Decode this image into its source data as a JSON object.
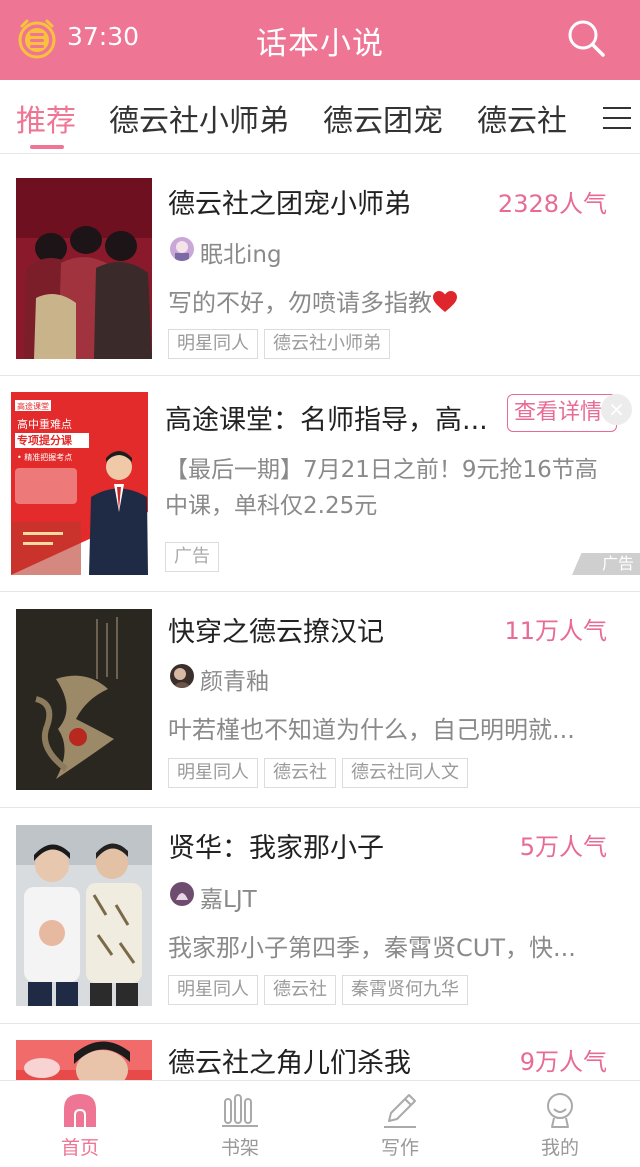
{
  "header": {
    "timer": "37:30",
    "title": "话本小说",
    "coin_icon": "coin-timer-icon",
    "search_icon": "search-icon"
  },
  "tabs": [
    {
      "label": "推荐",
      "active": true
    },
    {
      "label": "德云社小师弟"
    },
    {
      "label": "德云团宠"
    },
    {
      "label": "德云社"
    }
  ],
  "feed": {
    "books": [
      {
        "title": "德云社之团宠小师弟",
        "popularity": "2328人气",
        "author": "眠北ing",
        "description": "写的不好，勿喷请多指教",
        "tags": [
          "明星同人",
          "德云社小师弟"
        ]
      },
      {
        "title": "快穿之德云撩汉记",
        "popularity": "11万人气",
        "author": "颜青釉",
        "description": "叶若槿也不知道为什么，自己明明就...",
        "tags": [
          "明星同人",
          "德云社",
          "德云社同人文"
        ]
      },
      {
        "title": "贤华：我家那小子",
        "popularity": "5万人气",
        "author": "嘉LJT",
        "description": "我家那小子第四季，秦霄贤CUT，快...",
        "tags": [
          "明星同人",
          "德云社",
          "秦霄贤何九华"
        ]
      },
      {
        "title": "德云社之角儿们杀我",
        "popularity": "9万人气"
      }
    ],
    "ad": {
      "title": "高途课堂：名师指导，高...",
      "button": "查看详情",
      "close": "×",
      "description": "【最后一期】7月21日之前！9元抢16节高中课，单科仅2.25元",
      "tag": "广告",
      "mark": "广告",
      "cover": {
        "brand": "高途课堂",
        "line1": "高中重难点",
        "line2": "专项提分课",
        "line3": "• 精准把握考点"
      }
    }
  },
  "bottom_nav": [
    {
      "label": "首页",
      "icon": "home-icon",
      "active": true
    },
    {
      "label": "书架",
      "icon": "bookshelf-icon"
    },
    {
      "label": "写作",
      "icon": "pen-icon"
    },
    {
      "label": "我的",
      "icon": "profile-icon"
    }
  ],
  "colors": {
    "accent": "#ef7595",
    "popularity": "#e86b95",
    "muted": "#8a8a8a"
  }
}
